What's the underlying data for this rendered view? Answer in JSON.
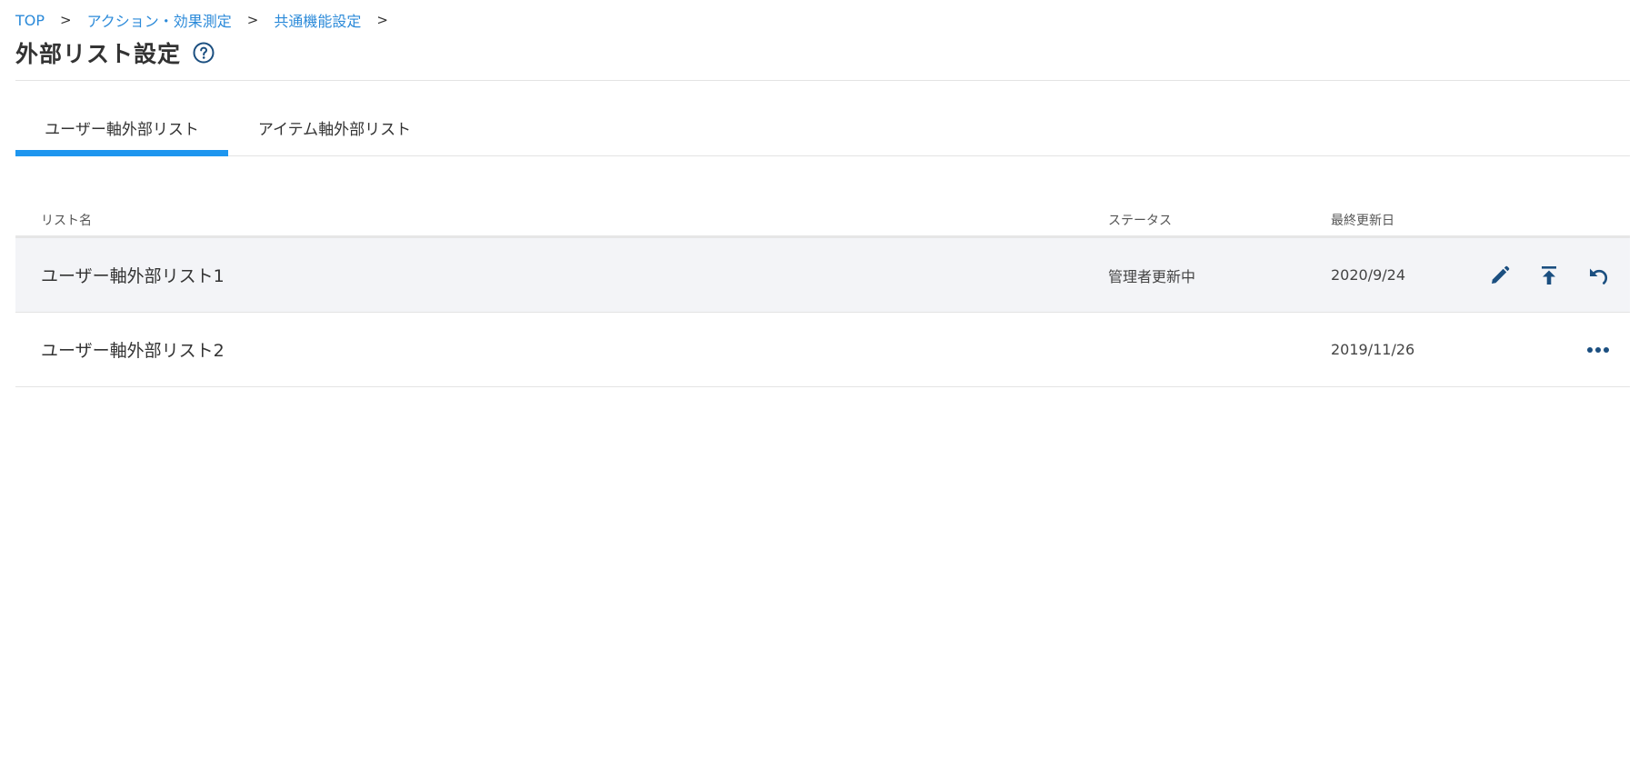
{
  "breadcrumb": {
    "items": [
      {
        "label": "TOP"
      },
      {
        "label": "アクション・効果測定"
      },
      {
        "label": "共通機能設定"
      }
    ],
    "separator": ">"
  },
  "page": {
    "title": "外部リスト設定",
    "help_icon": "question-circle-icon"
  },
  "tabs": [
    {
      "label": "ユーザー軸外部リスト",
      "active": true
    },
    {
      "label": "アイテム軸外部リスト",
      "active": false
    }
  ],
  "colors": {
    "accent": "#1e96ef",
    "link": "#2b8ad9",
    "icon": "#1b4f80",
    "row_highlight": "#f3f4f7"
  },
  "table": {
    "columns": {
      "name": "リスト名",
      "status": "ステータス",
      "updated": "最終更新日"
    },
    "rows": [
      {
        "name": "ユーザー軸外部リスト1",
        "status": "管理者更新中",
        "updated": "2020/9/24",
        "actions": [
          "pencil-icon",
          "upload-icon",
          "undo-icon"
        ]
      },
      {
        "name": "ユーザー軸外部リスト2",
        "status": "",
        "updated": "2019/11/26",
        "actions": [
          "more-horizontal-icon"
        ]
      }
    ]
  }
}
